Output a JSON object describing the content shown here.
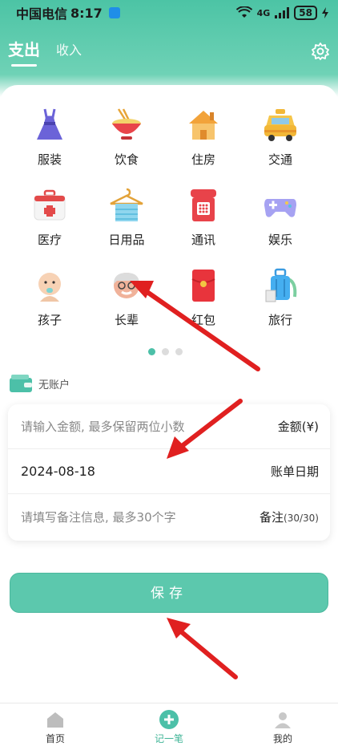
{
  "status": {
    "carrier": "中国电信",
    "time": "8:17",
    "signal": "4G",
    "battery": "58"
  },
  "header": {
    "tab_expense": "支出",
    "tab_income": "收入"
  },
  "categories": [
    {
      "label": "服装",
      "icon": "dress-icon"
    },
    {
      "label": "饮食",
      "icon": "food-bowl-icon"
    },
    {
      "label": "住房",
      "icon": "house-icon"
    },
    {
      "label": "交通",
      "icon": "taxi-icon"
    },
    {
      "label": "医疗",
      "icon": "medical-kit-icon"
    },
    {
      "label": "日用品",
      "icon": "towel-hanger-icon"
    },
    {
      "label": "通讯",
      "icon": "telephone-icon"
    },
    {
      "label": "娱乐",
      "icon": "gamepad-icon"
    },
    {
      "label": "孩子",
      "icon": "baby-icon"
    },
    {
      "label": "长辈",
      "icon": "elder-icon"
    },
    {
      "label": "红包",
      "icon": "red-envelope-icon"
    },
    {
      "label": "旅行",
      "icon": "suitcase-icon"
    }
  ],
  "account": {
    "label": "无账户"
  },
  "form": {
    "amount_placeholder": "请输入金额, 最多保留两位小数",
    "amount_label": "金额(¥)",
    "date_value": "2024-08-18",
    "date_label": "账单日期",
    "note_placeholder": "请填写备注信息, 最多30个字",
    "note_label": "备注",
    "note_counter": "(30/30)"
  },
  "save_label": "保存",
  "nav": {
    "home": "首页",
    "record": "记一笔",
    "mine": "我的"
  },
  "colors": {
    "accent": "#5cc8ad",
    "arrow": "#e02020"
  }
}
